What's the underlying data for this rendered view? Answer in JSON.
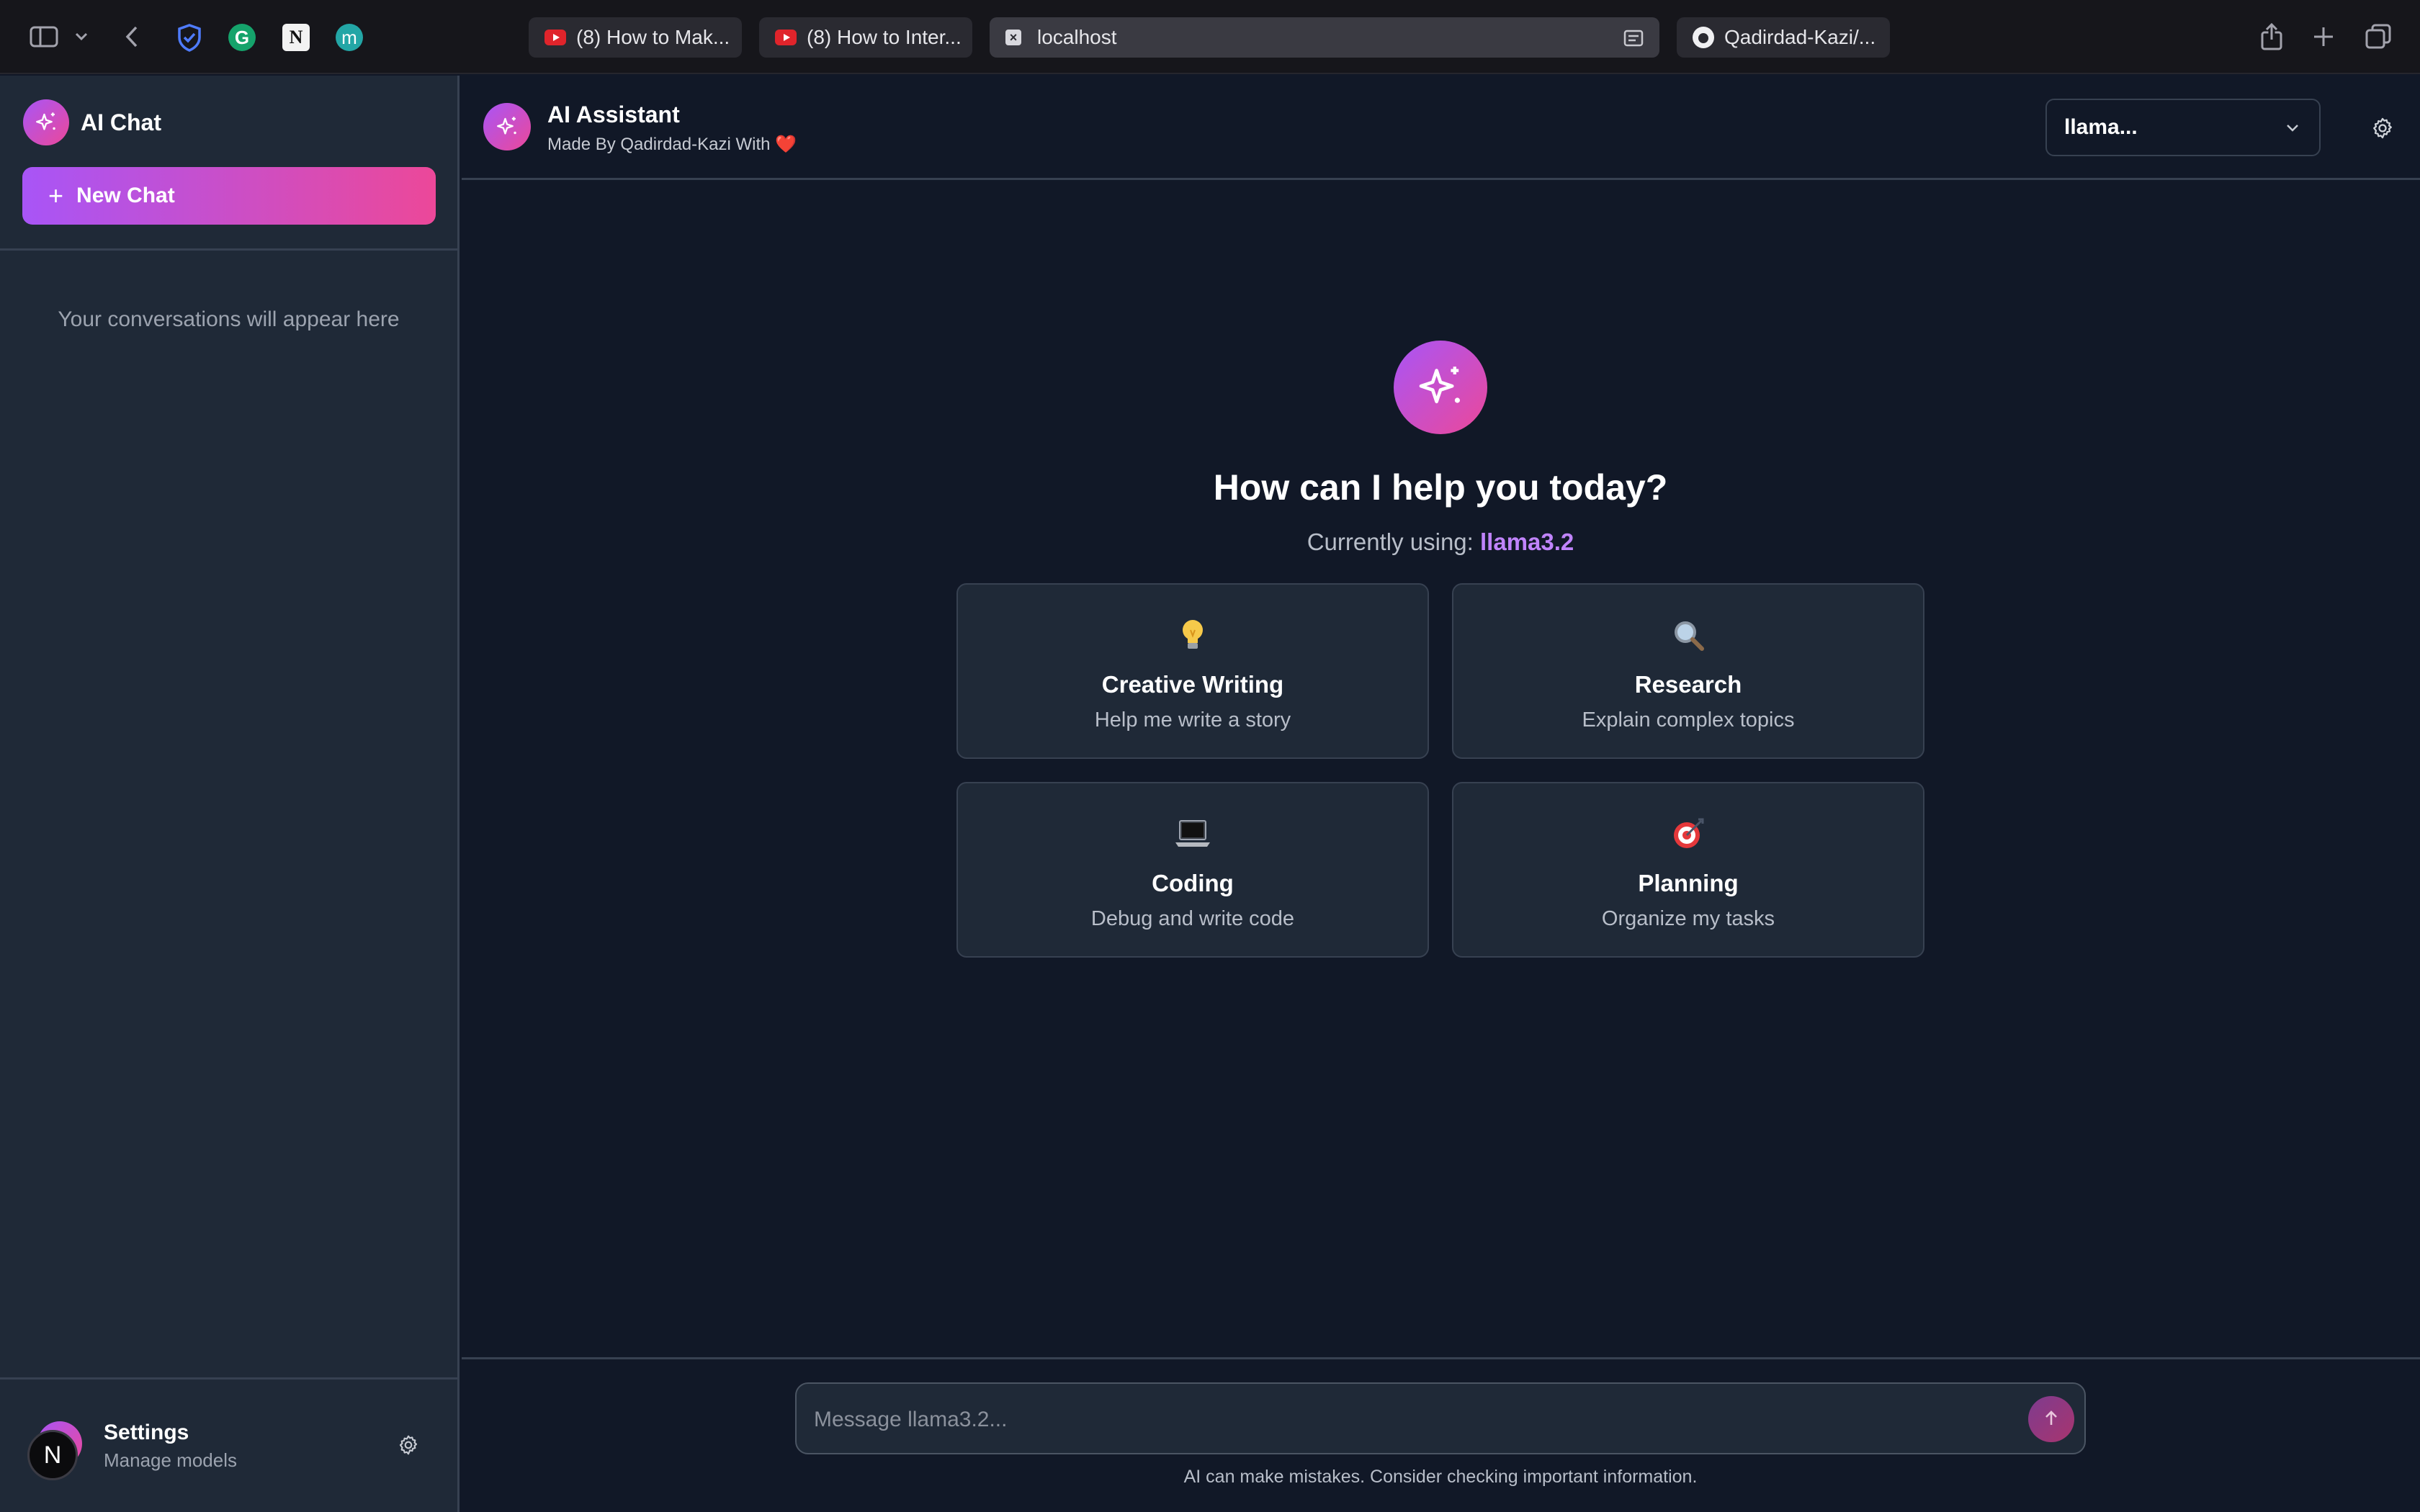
{
  "browser": {
    "tabs": [
      {
        "label": "(8) How to Mak...",
        "icon": "youtube-icon"
      },
      {
        "label": "(8) How to Inter...",
        "icon": "youtube-icon"
      },
      {
        "label": "localhost",
        "icon": "close-tab-icon",
        "active": true
      },
      {
        "label": "Qadirdad-Kazi/...",
        "icon": "github-icon"
      }
    ],
    "extensions": [
      {
        "name": "shield-extension-icon",
        "glyph": ""
      },
      {
        "name": "grammarly-extension-icon",
        "glyph": "G"
      },
      {
        "name": "notion-extension-icon",
        "glyph": "N"
      },
      {
        "name": "m-extension-icon",
        "glyph": "m"
      }
    ]
  },
  "sidebar": {
    "brand_title": "AI Chat",
    "new_chat_label": "New Chat",
    "empty_hint": "Your conversations will appear here",
    "footer": {
      "avatar_letter": "N",
      "title": "Settings",
      "subtitle": "Manage models"
    }
  },
  "header": {
    "title": "AI Assistant",
    "subtitle": "Made By Qadirdad-Kazi With ❤️",
    "model_select_value": "llama..."
  },
  "welcome": {
    "title": "How can I help you today?",
    "currently_using_label": "Currently using:",
    "model_name": "llama3.2"
  },
  "suggestions": [
    {
      "icon": "lightbulb-icon",
      "emoji": "💡",
      "title": "Creative Writing",
      "subtitle": "Help me write a story"
    },
    {
      "icon": "magnifier-icon",
      "emoji": "🔍",
      "title": "Research",
      "subtitle": "Explain complex topics"
    },
    {
      "icon": "laptop-icon",
      "emoji": "💻",
      "title": "Coding",
      "subtitle": "Debug and write code"
    },
    {
      "icon": "target-icon",
      "emoji": "🎯",
      "title": "Planning",
      "subtitle": "Organize my tasks"
    }
  ],
  "composer": {
    "placeholder": "Message llama3.2...",
    "disclaimer": "AI can make mistakes. Consider checking important information."
  },
  "colors": {
    "background": "#111827",
    "panel": "#1f2937",
    "border": "#374151",
    "accent_from": "#a855f7",
    "accent_to": "#ec4899",
    "model_highlight": "#c084fc"
  }
}
